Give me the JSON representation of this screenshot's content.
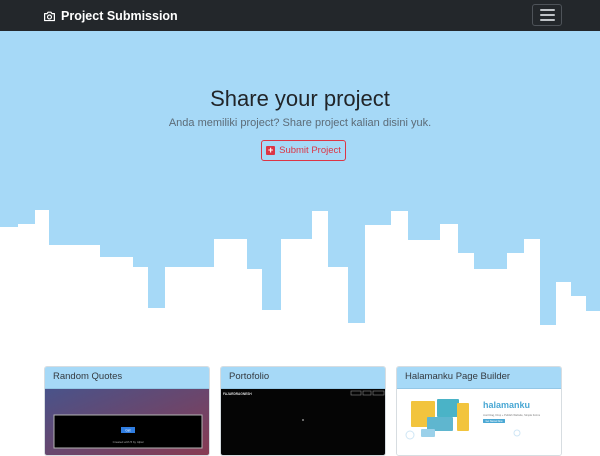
{
  "navbar": {
    "brand": "Project Submission",
    "brand_icon": "camera-icon",
    "toggler_icon": "hamburger-menu-icon",
    "background": "#23272b"
  },
  "hero": {
    "title": "Share your project",
    "subtitle": "Anda memiliki project? Share project kalian disini yuk.",
    "button_label": "Submit Project",
    "button_icon": "plus-square-icon",
    "background": "#a6d9f7",
    "accent": "#dc3545"
  },
  "cards": [
    {
      "title": "Random Quotes",
      "preview_button": "Get",
      "preview_caption": "Created with ♥ by Iqbal"
    },
    {
      "title": "Portofolio",
      "preview_brand": "FAJARDRAGNESH"
    },
    {
      "title": "Halamanku Page Builder",
      "preview_logo": "halamanku",
      "preview_tagline": "Just Drag, Drop + Publish Website, Simple Forms",
      "preview_button": "Get Started Now"
    }
  ]
}
